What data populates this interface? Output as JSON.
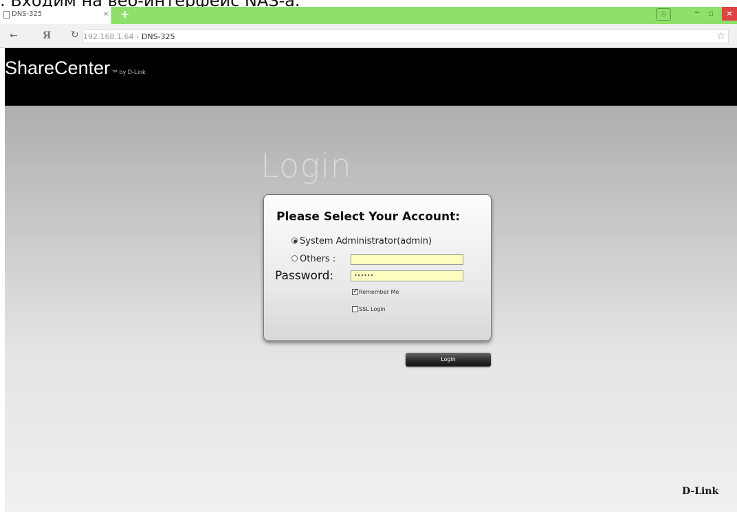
{
  "caption": {
    "text": ". Входим на веб-интерфейс NAS-a."
  },
  "browser": {
    "tab_title": "DNS-325",
    "tab_close": "×",
    "new_tab": "+",
    "nav_back": "←",
    "nav_yandex": "Я",
    "nav_reload": "↻",
    "url_host": "192.168.1.64",
    "url_sep": " › ",
    "url_page": "DNS-325",
    "bookmark_star": "☆",
    "win_minimize": "–",
    "win_maximize": "▫",
    "win_close": "×",
    "sync_icon": "◎",
    "tabbar_color": "#8ee06a"
  },
  "header": {
    "brand": "ShareCenter",
    "brand_sub": "™ by D-Link"
  },
  "login": {
    "heading": "Login",
    "box_title": "Please Select Your Account:",
    "option_admin": "System Administrator(admin)",
    "option_admin_selected": true,
    "option_others": "Others :",
    "others_value": "",
    "password_label": "Password:",
    "password_value": "••••••",
    "remember_label": "Remember Me",
    "remember_checked": true,
    "ssl_label": "SSL Login",
    "ssl_checked": false,
    "button": "Login",
    "field_color": "#fdfdc0"
  },
  "footer": {
    "logo": "D-Link"
  }
}
